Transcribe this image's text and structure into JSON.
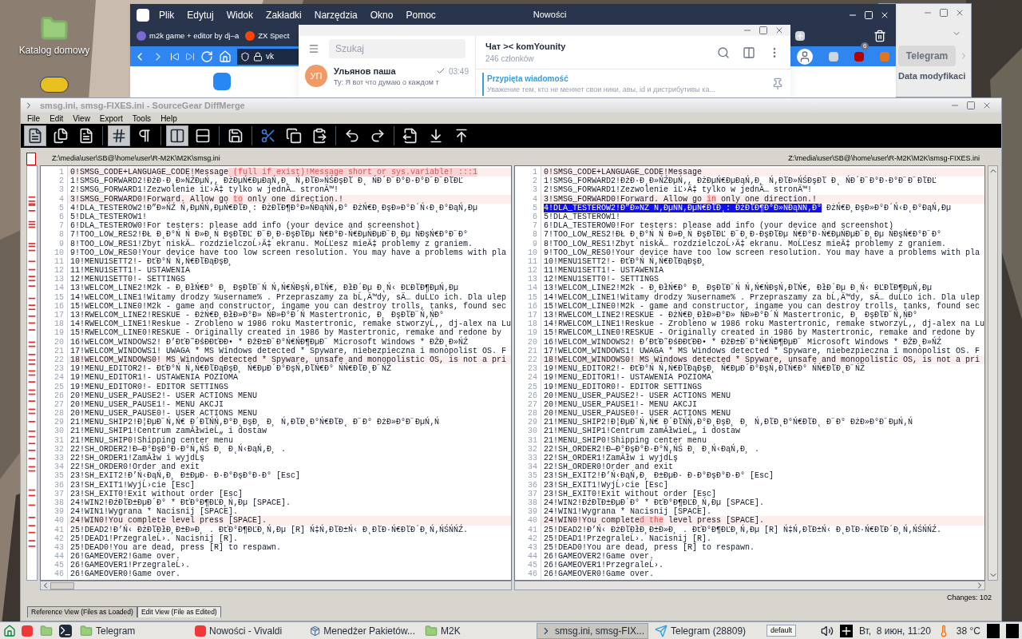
{
  "desktop": {
    "icons": [
      {
        "kind": "folder",
        "label": "Katalog domowy"
      },
      {
        "kind": "app"
      }
    ]
  },
  "browser": {
    "title": "Nowości",
    "menu": [
      "Plik",
      "Edytuj",
      "Widok",
      "Zakładki",
      "Narzędzia",
      "Okno",
      "Pomoc"
    ],
    "tabs": [
      {
        "label": "m2k game + editor by dj–a",
        "selected": false
      },
      {
        "label": "ZX Spect",
        "selected": false
      }
    ],
    "address": "vk",
    "extension_badge": "6"
  },
  "telegram": {
    "search": {
      "placeholder": "Szukaj"
    },
    "chats": [
      {
        "avatar": "УП",
        "name": "Ульянов паша",
        "time": "03:49",
        "read": true,
        "preview": "Ту: Я вот что думаю о каждом т"
      }
    ],
    "header": {
      "title": "Чат >< komYounity",
      "subtitle": "246 członków"
    },
    "pinned": {
      "label": "Przypięta wiadomość",
      "text": "Уважение тем, кто не меняет свои ники, авы, id и дистрибутивы ка..."
    }
  },
  "file_manager": {
    "button": "Telegram",
    "column": "Data modyfikaci"
  },
  "diffmerge": {
    "title": "smsg.ini, smsg-FIXES.ini - SourceGear DiffMerge",
    "menu": [
      "File",
      "Edit",
      "View",
      "Export",
      "Tools",
      "Help"
    ],
    "toolbar": [
      {
        "kind": "doc",
        "pressed": true
      },
      {
        "kind": "doc2",
        "pressed": false
      },
      {
        "kind": "doc3",
        "pressed": false
      },
      {
        "kind": "sep"
      },
      {
        "kind": "hash",
        "pressed": true
      },
      {
        "kind": "pilcrow",
        "pressed": false
      },
      {
        "kind": "sep"
      },
      {
        "kind": "columns",
        "pressed": true
      },
      {
        "kind": "rows",
        "pressed": false
      },
      {
        "kind": "sep"
      },
      {
        "kind": "save",
        "pressed": false
      },
      {
        "kind": "sep"
      },
      {
        "kind": "cut",
        "pressed": false
      },
      {
        "kind": "copy",
        "pressed": false
      },
      {
        "kind": "paste",
        "pressed": false
      },
      {
        "kind": "sep"
      },
      {
        "kind": "undo",
        "pressed": false
      },
      {
        "kind": "redo",
        "pressed": false
      },
      {
        "kind": "sep"
      },
      {
        "kind": "export",
        "pressed": false
      },
      {
        "kind": "next",
        "pressed": false
      },
      {
        "kind": "prev",
        "pressed": false
      }
    ],
    "panes": [
      {
        "path": "Z:\\media\\user\\SB@\\home\\user\\R-M2K\\M2K\\smsg.ini",
        "rows": [
          {
            "number": "1",
            "changed": true,
            "segments": [
              {
                "kind": "plain",
                "text": "0!SMSG_CODE+LANGUAGE_CODE!Message"
              },
              {
                "kind": "diff",
                "text": " (full if exist)!Message short or sys.variable! :::1"
              }
            ]
          },
          {
            "number": "2",
            "changed": false,
            "text": "1!SMSG_FORWARD2!ĐżĐ·Đ˛Đ»ŃŹĐµŃ‚, ĐżĐµŃ€ĐµĐąŃ‚Đ¸ Ń‚ĐľĐ»ŃŚĐşĐľ Đ˛ ŃĐ´Đ˝Đ°Đ·Đ°Đ˝Đ˝ĐľĐĽ"
          },
          {
            "number": "3",
            "changed": false,
            "text": "2!SMSG_FORWARD1!Zezwolenie iĽ›Ä‡ tylko w jednÄ… stronÄ™!"
          },
          {
            "number": "4",
            "changed": true,
            "segments": [
              {
                "kind": "plain",
                "text": "3!SMSG_FORWARD0!Forward. Allow go "
              },
              {
                "kind": "diff",
                "text": "to"
              },
              {
                "kind": "plain",
                "text": " only one direction.!"
              }
            ]
          },
          {
            "number": "5",
            "changed": false,
            "text": "4!DLA_TESTEROW2!Đ”Đ»ŃŹ Ń‚ĐµŃŃ‚ĐµŃ€ĐľĐ˛: ĐżĐľĐ¶Đ°Đ»ŃĐąŃŃ‚Đ° ĐżŃ€Đ¸ĐşĐ»Đ°Đ´Ń‹Đ˛Đ°ĐąŃ‚Đµ"
          },
          {
            "number": "6",
            "changed": false,
            "text": "5!DLA_TESTEROW1!"
          },
          {
            "number": "7",
            "changed": false,
            "text": "6!DLA_TESTEROW0!For testers: please add info (your device and screenshot)"
          },
          {
            "number": "8",
            "changed": false,
            "text": "7!TOO_LOW_RES2!ĐŁ Đ˛Đ°Ń Ń Đ»Đ¸Ń ĐşĐľĐĽ Đ˝Đ¸Đ·ĐşĐľĐµ Ń€Đ°Đ·Ń€ĐµŃĐµĐ˝Đ¸Đµ ŃĐşŃ€Đ°Đ˝Đ°"
          },
          {
            "number": "9",
            "changed": false,
            "text": "8!TOO_LOW_RES1!Zbyt niskÄ… rozdzielczoĹ›Ä‡ ekranu. MoĹĽesz mieÄ‡ problemy z graniem."
          },
          {
            "number": "10",
            "changed": false,
            "text": "9!TOO_LOW_RES0!Your device have too low screen resolution. You may have a problems with pla"
          },
          {
            "number": "11",
            "changed": false,
            "text": "10!MENU1SETT2!- ĐťĐ°Ń Ń‚Ń€ĐľĐąĐşĐ¸"
          },
          {
            "number": "12",
            "changed": false,
            "text": "11!MENU1SETT1!- USTAWENIA"
          },
          {
            "number": "13",
            "changed": false,
            "text": "12!MENU1SETT0!- SETTINGS"
          },
          {
            "number": "14",
            "changed": false,
            "text": "13!WELCOM_LINE2!M2k - Đ¸ĐłŃ€Đ° Đ¸ ĐşĐľĐ˝Ń Ń‚Ń€ŃĐşŃ‚ĐľŃ€, ĐłĐ´Đµ Đ˛Ń‹ ĐĽĐľĐ¶ĐµŃ‚Đµ"
          },
          {
            "number": "15",
            "changed": false,
            "text": "14!WELCOM_LINE1!Witamy drodzy %username% . Przepraszamy za bĹ‚Ä™dy, sÄ… duĹĽo ich. Dla ulep"
          },
          {
            "number": "16",
            "changed": false,
            "text": "15!WELCOM_LINE0!M2k - game and constructor, ingame you can destroy trolls, tanks, found sec"
          },
          {
            "number": "17",
            "changed": false,
            "text": "13!RWELCOM_LINE2!RESKUE - ĐżŃ€Đ¸ĐłĐ»Đ°Đ» ŃĐ»Đ°Đ´Ń Mastertronic, Đ¸ ĐşĐľĐ˝Ń‚ŃĐ°"
          },
          {
            "number": "18",
            "changed": false,
            "text": "14!RWELCOM_LINE1!Reskue - Zrobleno w 1986 roku Mastertronic, remake stworzyĹ‚, dj-alex na Lu"
          },
          {
            "number": "19",
            "changed": false,
            "text": "15!RWELCOM_LINE0!RESKUE - Originally created in 1986 by Mastertronic, remake and redone by"
          },
          {
            "number": "20",
            "changed": false,
            "text": "16!WELCOM_WINDOWS2! Đ’ĐťĐ˜ĐśĐĐťĐĐ• * ĐžĐ±Đ˝Đ°Ń€ŃĐ¶ĐµĐ˝ Microsoft Windows * ĐŻĐ˛Đ»ŃŹ"
          },
          {
            "number": "21",
            "changed": false,
            "text": "17!WELCOM_WINDOWS1! UWAGA * MS Windows detected * Spyware, niebezpieczna i monopolist OS. F"
          },
          {
            "number": "22",
            "changed": true,
            "text": "18!WELCOM_WINDOWS0! MS Windows detected * Spyware, unsafe and monopolistic OS, is not a pri"
          },
          {
            "number": "23",
            "changed": false,
            "text": "19!MENU_EDITOR2!- ĐťĐ°Ń Ń‚Ń€ĐľĐąĐşĐ¸ Ń€ĐµĐ´Đ°ĐşŃ‚ĐľŃ€Đ° ŃŃ€ĐľĐ˛Đ˝ŃŹ"
          },
          {
            "number": "24",
            "changed": false,
            "text": "19!MENU_EDITOR1!- USTAWENIA POZIOMA"
          },
          {
            "number": "25",
            "changed": false,
            "text": "19!MENU_EDITOR0!- EDITOR SETTINGS"
          },
          {
            "number": "26",
            "changed": false,
            "text": "20!MENU_USER_PAUSE2!- USER ACTIONS MENU"
          },
          {
            "number": "27",
            "changed": false,
            "text": "20!MENU_USER_PAUSE1!- MENU AKCJI"
          },
          {
            "number": "28",
            "changed": false,
            "text": "20!MENU_USER_PAUSE0!- USER ACTIONS MENU"
          },
          {
            "number": "29",
            "changed": false,
            "text": "21!MENU_SHIP2!Đ¦ĐµĐ˝Ń‚Ń€ Đ´ĐľŃŃ‚Đ°Đ˛ĐşĐ¸ Đ¸ Ń‚ĐľĐ˛Đ°Ń€ĐľĐ˛ Đ˝Đ° ĐżĐ»Đ°Đ˝ĐµŃ‚Ń"
          },
          {
            "number": "30",
            "changed": false,
            "text": "21!MENU_SHIP1!Centrum zamĂłwieĹ„ i dostaw"
          },
          {
            "number": "31",
            "changed": false,
            "text": "21!MENU_SHIP0!Shipping center menu"
          },
          {
            "number": "32",
            "changed": false,
            "text": "22!SH_ORDER2!Đ—Đ°ĐşĐ°Đ·Đ°Ń‚ŃŚ Đ¸ Đ˛Ń‹ĐąŃ‚Đ¸ ."
          },
          {
            "number": "33",
            "changed": false,
            "text": "22!SH_ORDER1!ZamĂłw i wyjdĹş"
          },
          {
            "number": "34",
            "changed": false,
            "text": "22!SH_ORDER0!Order and exit"
          },
          {
            "number": "35",
            "changed": false,
            "text": "23!SH_EXIT2!Đ’Ń‹ĐąŃ‚Đ¸ Đ±ĐµĐ· Đ·Đ°ĐşĐ°Đ·Đ° [Esc]"
          },
          {
            "number": "36",
            "changed": false,
            "text": "23!SH_EXIT1!WyjĹ›cie [Esc]"
          },
          {
            "number": "37",
            "changed": false,
            "text": "23!SH_EXIT0!Exit without order [Esc]"
          },
          {
            "number": "38",
            "changed": false,
            "text": "24!WIN2!ĐźĐľĐ±ĐµĐ´Đ° * ĐťĐ°Đ¶ĐĽĐ¸Ń‚Đµ [SPACE]."
          },
          {
            "number": "39",
            "changed": false,
            "text": "24!WIN1!Wygrana * Nacisnij [SPACE]."
          },
          {
            "number": "40",
            "changed": true,
            "text": "24!WIN0!You complete level press [SPACE]."
          },
          {
            "number": "41",
            "changed": false,
            "text": "25!DEAD2!Đ’Ń‹ ĐżĐľĐłĐ¸Đ±Đ»Đ¸ . ĐťĐ°Đ¶ĐĽĐ¸Ń‚Đµ [R] Ń‡Ń‚ĐľĐ±Ń‹ Đ˛ĐľĐ·Ń€ĐľĐ´Đ¸Ń‚ŃŚŃŃŹ."
          },
          {
            "number": "42",
            "changed": false,
            "text": "25!DEAD1!PrzegraleĹ›. Nacisnij [R]."
          },
          {
            "number": "43",
            "changed": false,
            "text": "25!DEAD0!You are dead, press [R] to respawn."
          },
          {
            "number": "44",
            "changed": false,
            "text": "26!GAMEOVER2!Game over."
          },
          {
            "number": "45",
            "changed": false,
            "text": "26!GAMEOVER1!PrzegraleĹ›."
          },
          {
            "number": "46",
            "changed": false,
            "text": "26!GAMEOVER0!Game over."
          }
        ]
      },
      {
        "path": "Z:\\media\\user\\SB@\\home\\user\\R-M2K\\M2K\\smsg-FIXES.ini",
        "rows": [
          {
            "number": "1",
            "changed": true,
            "text": "0!SMSG_CODE+LANGUAGE_CODE!Message"
          },
          {
            "number": "2",
            "changed": false,
            "text": "1!SMSG_FORWARD2!ĐżĐ·Đ˛Đ»ŃŹĐµŃ‚, ĐżĐµŃ€ĐµĐąŃ‚Đ¸ Ń‚ĐľĐ»ŃŚĐşĐľ Đ˛ ŃĐ´Đ˝Đ°Đ·Đ°Đ˝Đ˝ĐľĐĽ"
          },
          {
            "number": "3",
            "changed": false,
            "text": "2!SMSG_FORWARD1!Zezwolenie iĽ›Ä‡ tylko w jednÄ… stronÄ™!"
          },
          {
            "number": "4",
            "changed": true,
            "segments": [
              {
                "kind": "plain",
                "text": "3!SMSG_FORWARD0!Forward. Allow go "
              },
              {
                "kind": "diff",
                "text": "in"
              },
              {
                "kind": "plain",
                "text": " only one direction.!"
              }
            ]
          },
          {
            "number": "5",
            "changed": false,
            "segments": [
              {
                "kind": "selected",
                "text": "4!DLA_TESTEROW2!Đ”Đ»ŃŹ Ń‚ĐµŃŃ‚ĐµŃ€ĐľĐ˛: ĐżĐľĐ¶Đ°Đ»ŃĐąŃŃ‚Đ°"
              },
              {
                "kind": "plain",
                "text": " ĐżŃ€Đ¸ĐşĐ»Đ°Đ´Ń‹Đ˛Đ°ĐąŃ‚Đµ"
              }
            ]
          },
          {
            "number": "6",
            "changed": false,
            "text": "5!DLA_TESTEROW1!"
          },
          {
            "number": "7",
            "changed": false,
            "text": "6!DLA_TESTEROW0!For testers: please add info (your device and screenshot)"
          },
          {
            "number": "8",
            "changed": false,
            "text": "7!TOO_LOW_RES2!ĐŁ Đ˛Đ°Ń Ń Đ»Đ¸Ń ĐşĐľĐĽ Đ˝Đ¸Đ·ĐşĐľĐµ Ń€Đ°Đ·Ń€ĐµŃĐµĐ˝Đ¸Đµ ŃĐşŃ€Đ°Đ˝Đ°"
          },
          {
            "number": "9",
            "changed": false,
            "text": "8!TOO_LOW_RES1!Zbyt niskÄ… rozdzielczoĹ›Ä‡ ekranu. MoĹĽesz mieÄ‡ problemy z graniem."
          },
          {
            "number": "10",
            "changed": false,
            "text": "9!TOO_LOW_RES0!Your device have too low screen resolution. You may have a problems with pla"
          },
          {
            "number": "11",
            "changed": false,
            "text": "10!MENU1SETT2!- ĐťĐ°Ń Ń‚Ń€ĐľĐąĐşĐ¸"
          },
          {
            "number": "12",
            "changed": false,
            "text": "11!MENU1SETT1!- USTAWENIA"
          },
          {
            "number": "13",
            "changed": false,
            "text": "12!MENU1SETT0!- SETTINGS"
          },
          {
            "number": "14",
            "changed": false,
            "text": "13!WELCOM_LINE2!M2k - Đ¸ĐłŃ€Đ° Đ¸ ĐşĐľĐ˝Ń Ń‚Ń€ŃĐşŃ‚ĐľŃ€, ĐłĐ´Đµ Đ˛Ń‹ ĐĽĐľĐ¶ĐµŃ‚Đµ"
          },
          {
            "number": "15",
            "changed": false,
            "text": "14!WELCOM_LINE1!Witamy drodzy %username% . Przepraszamy za bĹ‚Ä™dy, sÄ… duĹĽo ich. Dla ulep"
          },
          {
            "number": "16",
            "changed": false,
            "text": "15!WELCOM_LINE0!M2k - game and constructor, ingame you can destroy trolls, tanks, found sec"
          },
          {
            "number": "17",
            "changed": false,
            "text": "13!RWELCOM_LINE2!RESKUE - ĐżŃ€Đ¸ĐłĐ»Đ°Đ» ŃĐ»Đ°Đ´Ń Mastertronic, Đ¸ ĐşĐľĐ˝Ń‚ŃĐ°"
          },
          {
            "number": "18",
            "changed": false,
            "text": "14!RWELCOM_LINE1!Reskue - Zrobleno w 1986 roku Mastertronic, remake stworzyĹ‚, dj-alex na Lu"
          },
          {
            "number": "19",
            "changed": false,
            "text": "15!RWELCOM_LINE0!RESKUE - Originally created in 1986 by Mastertronic, remake and redone by"
          },
          {
            "number": "20",
            "changed": false,
            "text": "16!WELCOM_WINDOWS2! Đ’ĐťĐ˜ĐśĐĐťĐĐ• * ĐžĐ±Đ˝Đ°Ń€ŃĐ¶ĐµĐ˝ Microsoft Windows * ĐŻĐ˛Đ»ŃŹ"
          },
          {
            "number": "21",
            "changed": false,
            "text": "17!WELCOM_WINDOWS1! UWAGA * MS Windows detected * Spyware, niebezpieczna i monopolist OS. F"
          },
          {
            "number": "22",
            "changed": true,
            "text": "18!WELCOM_WINDOWS0! MS Windows detected * Spyware, unsafe and monopolistic OS, is not a pri"
          },
          {
            "number": "23",
            "changed": false,
            "text": "19!MENU_EDITOR2!- ĐťĐ°Ń Ń‚Ń€ĐľĐąĐşĐ¸ Ń€ĐµĐ´Đ°ĐşŃ‚ĐľŃ€Đ° ŃŃ€ĐľĐ˛Đ˝ŃŹ"
          },
          {
            "number": "24",
            "changed": false,
            "text": "19!MENU_EDITOR1!- USTAWENIA POZIOMA"
          },
          {
            "number": "25",
            "changed": false,
            "text": "19!MENU_EDITOR0!- EDITOR SETTINGS"
          },
          {
            "number": "26",
            "changed": false,
            "text": "20!MENU_USER_PAUSE2!- USER ACTIONS MENU"
          },
          {
            "number": "27",
            "changed": false,
            "text": "20!MENU_USER_PAUSE1!- MENU AKCJI"
          },
          {
            "number": "28",
            "changed": false,
            "text": "20!MENU_USER_PAUSE0!- USER ACTIONS MENU"
          },
          {
            "number": "29",
            "changed": false,
            "text": "21!MENU_SHIP2!Đ¦ĐµĐ˝Ń‚Ń€ Đ´ĐľŃŃ‚Đ°Đ˛ĐşĐ¸ Đ¸ Ń‚ĐľĐ˛Đ°Ń€ĐľĐ˛ Đ˝Đ° ĐżĐ»Đ°Đ˝ĐµŃ‚Ń"
          },
          {
            "number": "30",
            "changed": false,
            "text": "21!MENU_SHIP1!Centrum zamĂłwieĹ„ i dostaw"
          },
          {
            "number": "31",
            "changed": false,
            "text": "21!MENU_SHIP0!Shipping center menu"
          },
          {
            "number": "32",
            "changed": false,
            "text": "22!SH_ORDER2!Đ—Đ°ĐşĐ°Đ·Đ°Ń‚ŃŚ Đ¸ Đ˛Ń‹ĐąŃ‚Đ¸ ."
          },
          {
            "number": "33",
            "changed": false,
            "text": "22!SH_ORDER1!ZamĂłw i wyjdĹş"
          },
          {
            "number": "34",
            "changed": false,
            "text": "22!SH_ORDER0!Order and exit"
          },
          {
            "number": "35",
            "changed": false,
            "text": "23!SH_EXIT2!Đ’Ń‹ĐąŃ‚Đ¸ Đ±ĐµĐ· Đ·Đ°ĐşĐ°Đ·Đ° [Esc]"
          },
          {
            "number": "36",
            "changed": false,
            "text": "23!SH_EXIT1!WyjĹ›cie [Esc]"
          },
          {
            "number": "37",
            "changed": false,
            "text": "23!SH_EXIT0!Exit without order [Esc]"
          },
          {
            "number": "38",
            "changed": false,
            "text": "24!WIN2!ĐźĐľĐ±ĐµĐ´Đ° * ĐťĐ°Đ¶ĐĽĐ¸Ń‚Đµ [SPACE]."
          },
          {
            "number": "39",
            "changed": false,
            "text": "24!WIN1!Wygrana * Nacisnij [SPACE]."
          },
          {
            "number": "40",
            "changed": true,
            "segments": [
              {
                "kind": "plain",
                "text": "24!WIN0!You complete"
              },
              {
                "kind": "diff",
                "text": "d the"
              },
              {
                "kind": "plain",
                "text": " level press [SPACE]."
              }
            ]
          },
          {
            "number": "41",
            "changed": false,
            "text": "25!DEAD2!Đ’Ń‹ ĐżĐľĐłĐ¸Đ±Đ»Đ¸ . ĐťĐ°Đ¶ĐĽĐ¸Ń‚Đµ [R] Ń‡Ń‚ĐľĐ±Ń‹ Đ˛ĐľĐ·Ń€ĐľĐ´Đ¸Ń‚ŃŚŃŃŹ."
          },
          {
            "number": "42",
            "changed": false,
            "text": "25!DEAD1!PrzegraleĹ›. Nacisnij [R]."
          },
          {
            "number": "43",
            "changed": false,
            "text": "25!DEAD0!You are dead, press [R] to respawn."
          },
          {
            "number": "44",
            "changed": false,
            "text": "26!GAMEOVER2!Game over."
          },
          {
            "number": "45",
            "changed": false,
            "text": "26!GAMEOVER1!PrzegraleĹ›."
          },
          {
            "number": "46",
            "changed": false,
            "text": "26!GAMEOVER0!Game over."
          }
        ]
      }
    ],
    "status": "Changes: 102",
    "view_tabs": [
      {
        "label": "Reference View (Files as Loaded)",
        "selected": false
      },
      {
        "label": "Edit View (File as Edited)",
        "selected": true
      }
    ]
  },
  "taskbar": {
    "launchers": [
      {
        "kind": "vivaldi"
      },
      {
        "kind": "folder"
      },
      {
        "kind": "terminal"
      }
    ],
    "tasks": [
      {
        "label": "Telegram",
        "kind": "folder",
        "selected": false
      },
      {
        "label": "Nowości - Vivaldi",
        "kind": "vivaldi",
        "selected": false
      },
      {
        "label": "Menedżer Pakietów...",
        "kind": "package",
        "selected": false
      },
      {
        "label": "M2K",
        "kind": "folder",
        "selected": false
      },
      {
        "label": "smsg.ini, smsg-FIX...",
        "kind": "diffmerge",
        "selected": true
      },
      {
        "label": "Telegram (28809)",
        "kind": "telegram",
        "selected": false
      }
    ],
    "tooltip": "default",
    "clock": "Вт,  8 июн, 11:20",
    "temperature": "38 °C"
  }
}
